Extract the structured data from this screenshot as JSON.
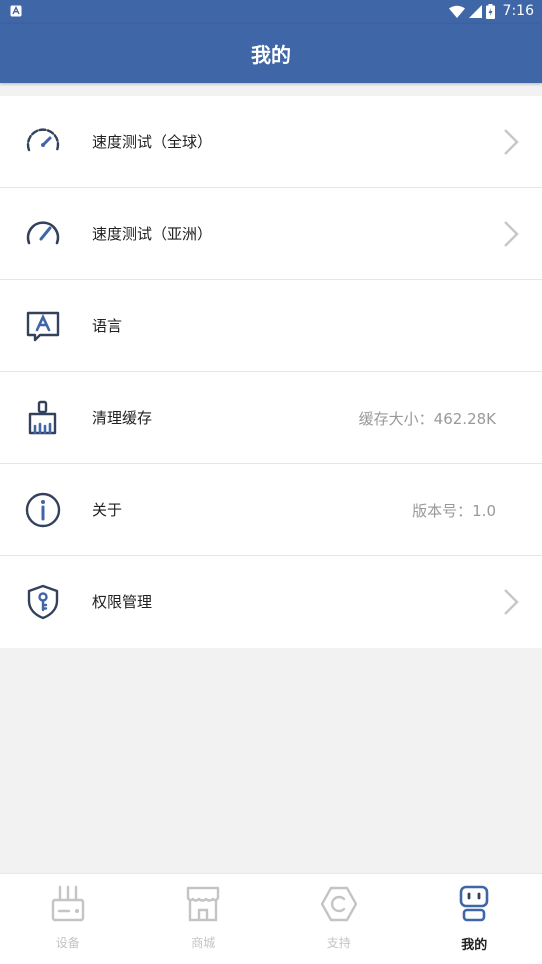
{
  "status_bar": {
    "time": "7:16"
  },
  "app_bar": {
    "title": "我的"
  },
  "list": {
    "items": [
      {
        "label": "速度测试（全球）",
        "value": "",
        "icon": "speedometer-icon",
        "chevron": true
      },
      {
        "label": "速度测试（亚洲）",
        "value": "",
        "icon": "gauge-icon",
        "chevron": true
      },
      {
        "label": "语言",
        "value": "",
        "icon": "language-icon",
        "chevron": false
      },
      {
        "label": "清理缓存",
        "value": "缓存大小：462.28K",
        "icon": "broom-icon",
        "chevron": false
      },
      {
        "label": "关于",
        "value": "版本号：1.0",
        "icon": "info-icon",
        "chevron": false
      },
      {
        "label": "权限管理",
        "value": "",
        "icon": "shield-key-icon",
        "chevron": true
      }
    ]
  },
  "bottom_nav": {
    "active": "我的",
    "items": [
      {
        "label": "设备",
        "icon": "router-icon"
      },
      {
        "label": "商城",
        "icon": "store-icon"
      },
      {
        "label": "支持",
        "icon": "support-icon"
      },
      {
        "label": "我的",
        "icon": "robot-icon"
      }
    ]
  },
  "colors": {
    "primary": "#3f66a6",
    "icon_dark": "#33415c",
    "icon_accent": "#3f66a6",
    "muted": "#999999",
    "nav_inactive": "#c4c4c4"
  }
}
